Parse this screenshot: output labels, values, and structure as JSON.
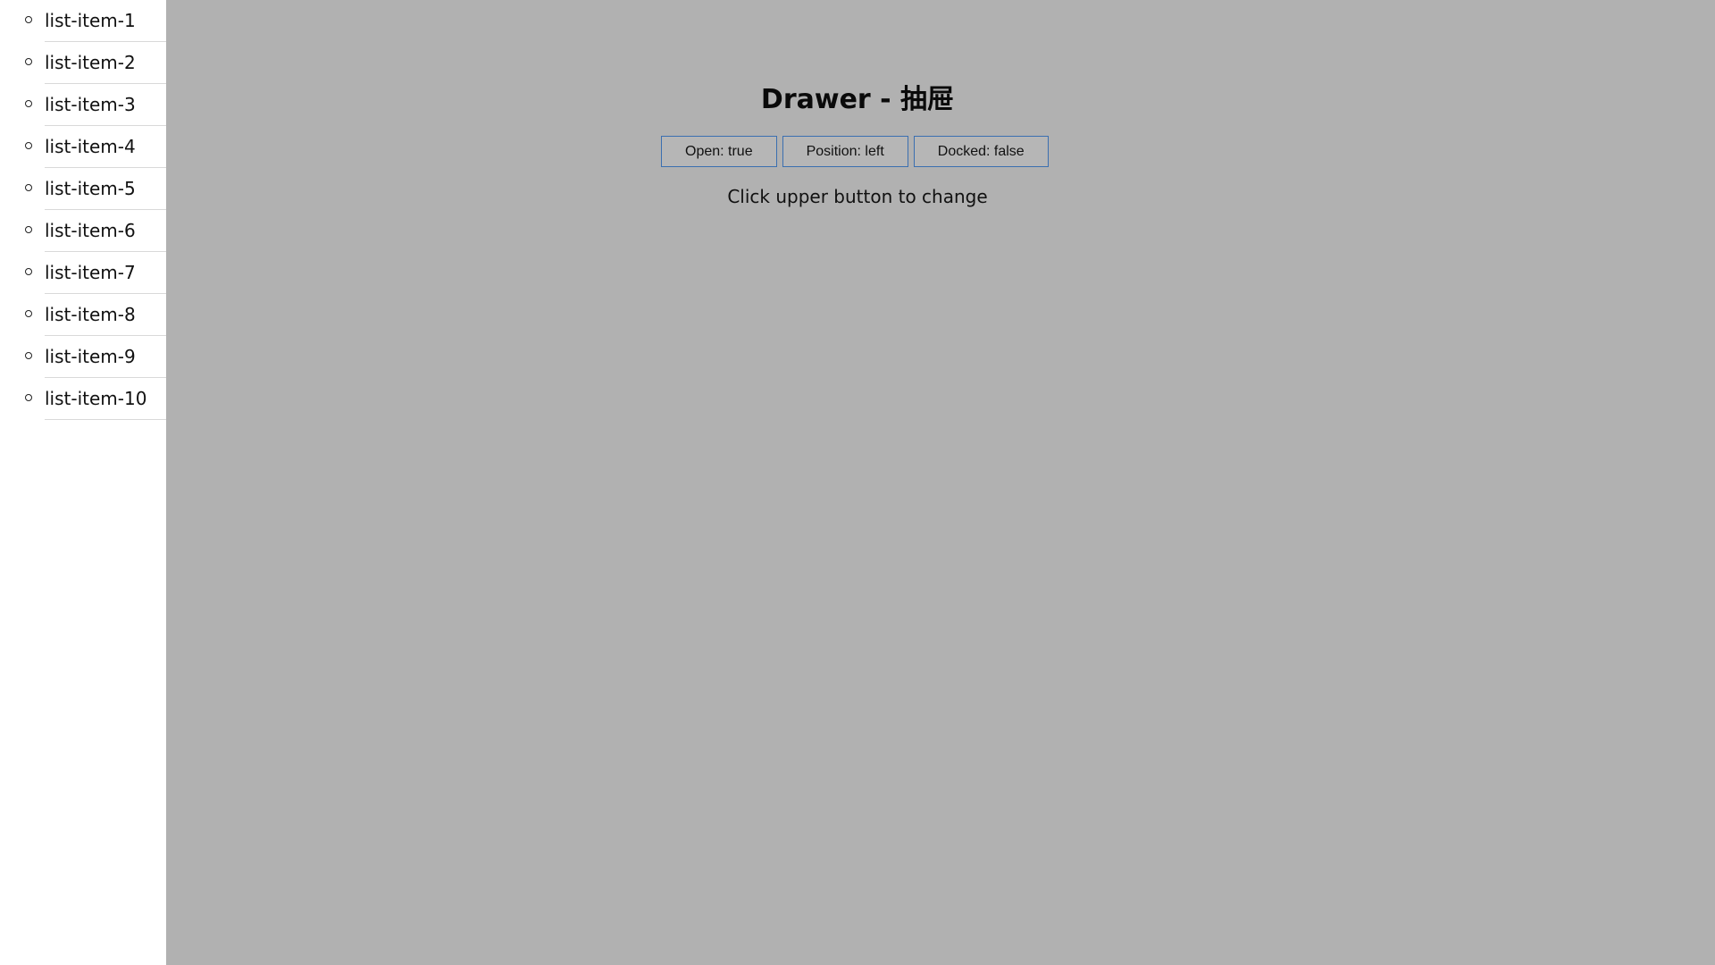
{
  "drawer": {
    "items": [
      {
        "label": "list-item-1"
      },
      {
        "label": "list-item-2"
      },
      {
        "label": "list-item-3"
      },
      {
        "label": "list-item-4"
      },
      {
        "label": "list-item-5"
      },
      {
        "label": "list-item-6"
      },
      {
        "label": "list-item-7"
      },
      {
        "label": "list-item-8"
      },
      {
        "label": "list-item-9"
      },
      {
        "label": "list-item-10"
      }
    ]
  },
  "main": {
    "title": "Drawer - 抽屉",
    "buttons": {
      "open": "Open: true",
      "position": "Position: left",
      "docked": "Docked: false"
    },
    "hint": "Click upper button to change"
  },
  "colors": {
    "overlay": "#b1b1b1",
    "drawer_bg": "#ffffff",
    "button_border": "#3b6fb0"
  }
}
